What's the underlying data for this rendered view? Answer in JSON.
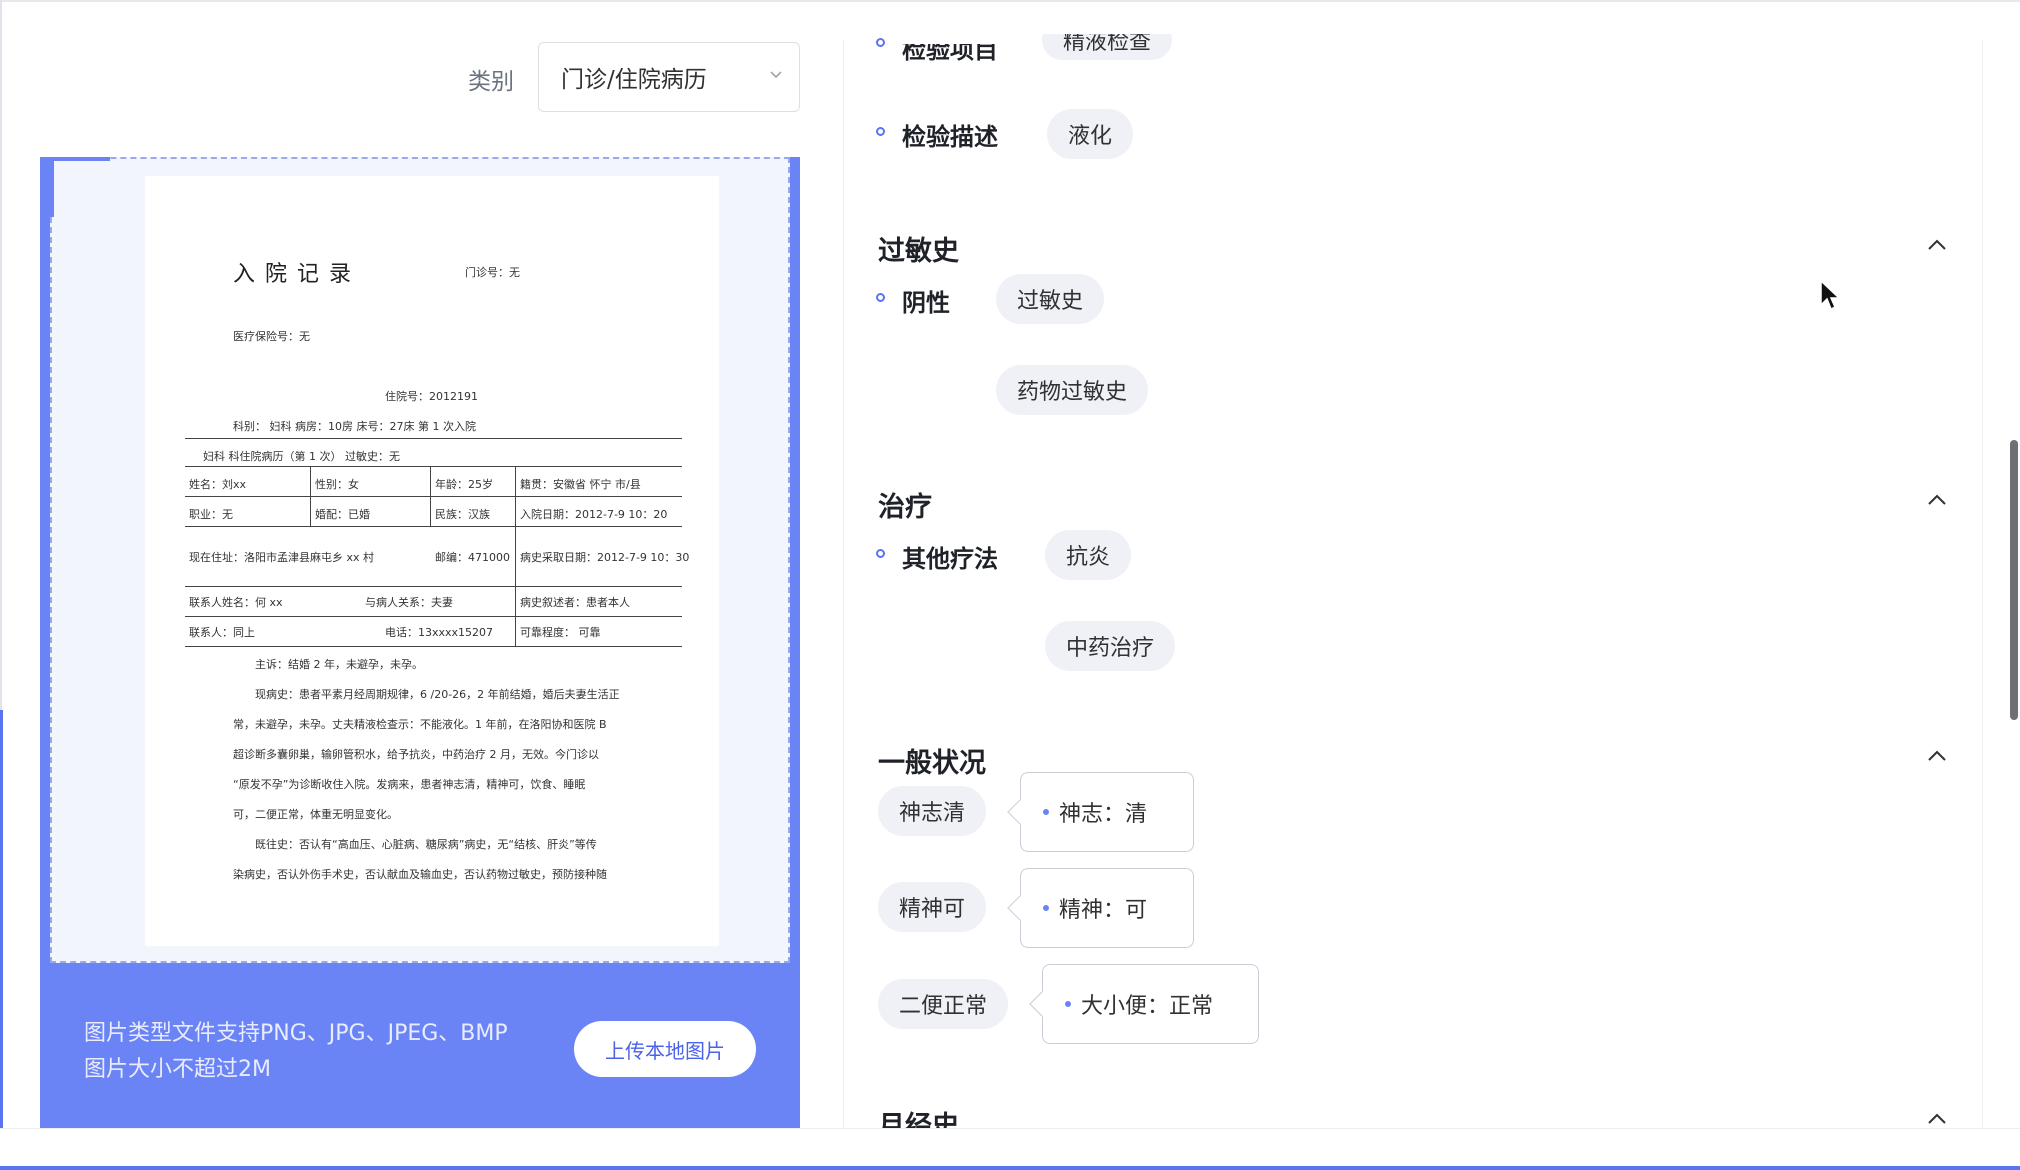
{
  "filter": {
    "category_label": "类别",
    "category_value": "门诊/住院病历"
  },
  "document": {
    "title": "入院记录",
    "outpatient_no": "门诊号：无",
    "insurance_no": "医疗保险号：无",
    "admission_no": "住院号：2012191",
    "dept_row": "科别：  妇科     病房：10房          床号：27床        第  1  次入院",
    "history_row": "妇科         科住院病历（第 1 次）           过敏史：无",
    "table": [
      [
        "姓名：刘xx",
        "性别：女",
        "年龄：25岁",
        "籍贯：安徽省  怀宁  市/县"
      ],
      [
        "职业：无",
        "婚配：已婚",
        "民族：汉族",
        "入院日期：2012-7-9   10：20"
      ],
      [
        "现在住址：洛阳市孟津县麻屯乡 xx 村",
        "",
        "邮编：471000",
        "病史采取日期：2012-7-9  10：30"
      ],
      [
        "联系人姓名：何 xx",
        "与病人关系：夫妻",
        "",
        "病史叙述者：患者本人"
      ],
      [
        "联系人：同上",
        "电话：13xxxx15207",
        "",
        "可靠程度：  可靠"
      ]
    ],
    "body_lines": [
      "主诉：结婚 2 年，未避孕，未孕。",
      "现病史：患者平素月经周期规律，6 /20-26，2 年前结婚，婚后夫妻生活正",
      "常，未避孕，未孕。丈夫精液检查示：不能液化。1 年前，在洛阳协和医院 B",
      "超诊断多囊卵巢，输卵管积水，给予抗炎，中药治疗 2 月，无效。今门诊以",
      "“原发不孕”为诊断收住入院。发病来，患者神志清，精神可，饮食、睡眠",
      "可，二便正常，体重无明显变化。",
      "既往史：否认有“高血压、心脏病、糖尿病”病史，无“结核、肝炎”等传",
      "染病史，否认外伤手术史，否认献血及输血史，否认药物过敏史，预防接种随"
    ]
  },
  "upload": {
    "hint_line1": "图片类型文件支持PNG、JPG、JPEG、BMP",
    "hint_line2": "图片大小不超过2M",
    "button_label": "上传本地图片"
  },
  "right_panel": {
    "partial_top": {
      "label": "检验项目",
      "tag": "精液检查"
    },
    "exam_desc": {
      "label": "检验描述",
      "tag": "液化"
    },
    "sections": {
      "allergy": {
        "title": "过敏史",
        "item_label": "阴性",
        "tags": [
          "过敏史",
          "药物过敏史"
        ]
      },
      "treatment": {
        "title": "治疗",
        "item_label": "其他疗法",
        "tags": [
          "抗炎",
          "中药治疗"
        ]
      },
      "general": {
        "title": "一般状况",
        "rows": [
          {
            "tag": "神志清",
            "callout": "神志：清"
          },
          {
            "tag": "精神可",
            "callout": "精神：可"
          },
          {
            "tag": "二便正常",
            "callout": "大小便：正常"
          }
        ]
      },
      "menstrual": {
        "title": "月经史"
      }
    }
  },
  "icons": {
    "dropdown": "chevron-down-icon",
    "collapse": "chevron-up-icon",
    "cursor": "mouse-pointer-icon"
  },
  "colors": {
    "accent": "#5a73f0",
    "upload_panel": "#6b84f5",
    "tag_bg": "#f0f1f6"
  }
}
